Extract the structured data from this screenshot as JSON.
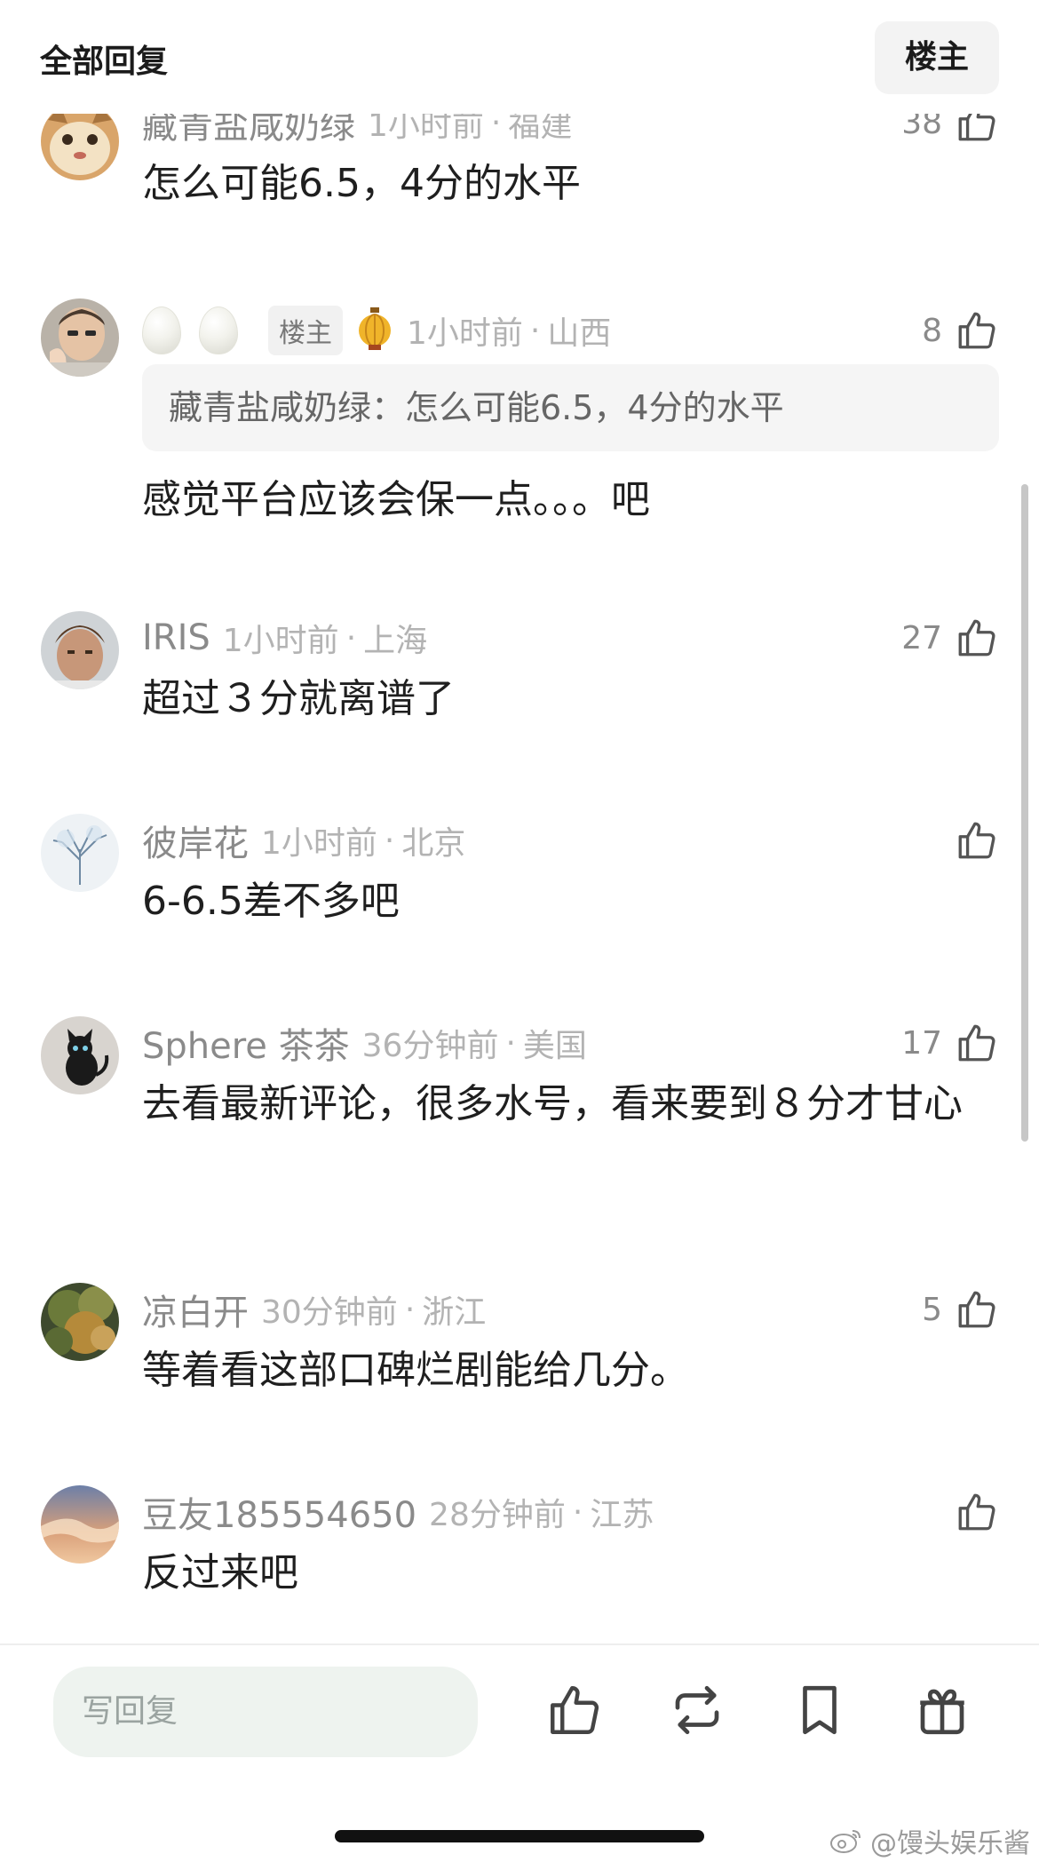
{
  "header": {
    "title": "全部回复",
    "op_button": "楼主"
  },
  "comments": [
    {
      "name": "藏青盐咸奶绿",
      "time": "1小时前",
      "location": "福建",
      "likes": "38",
      "text": "怎么可能6.5，4分的水平"
    },
    {
      "name": "",
      "badge": "楼主",
      "time": "1小时前",
      "location": "山西",
      "likes": "8",
      "quote": "藏青盐咸奶绿：怎么可能6.5，4分的水平",
      "text": "感觉平台应该会保一点。。。吧"
    },
    {
      "name": "IRIS",
      "time": "1小时前",
      "location": "上海",
      "likes": "27",
      "text": "超过３分就离谱了"
    },
    {
      "name": "彼岸花",
      "time": "1小时前",
      "location": "北京",
      "likes": "",
      "text": "6-6.5差不多吧"
    },
    {
      "name": "Sphere 茶茶",
      "time": "36分钟前",
      "location": "美国",
      "likes": "17",
      "text": "去看最新评论，很多水号，看来要到８分才甘心"
    },
    {
      "name": "凉白开",
      "time": "30分钟前",
      "location": "浙江",
      "likes": "5",
      "text": "等着看这部口碑烂剧能给几分。"
    },
    {
      "name": "豆友185554650",
      "time": "28分钟前",
      "location": "江苏",
      "likes": "",
      "text": "反过来吧"
    }
  ],
  "separator": "·",
  "bottom": {
    "reply_placeholder": "写回复",
    "watermark": "@馒头娱乐酱"
  },
  "icons": {
    "like": "thumbs-up-icon",
    "repost": "repost-icon",
    "bookmark": "bookmark-icon",
    "gift": "gift-icon",
    "weibo": "weibo-logo-icon",
    "lantern": "lantern-icon",
    "egg": "egg-icon"
  },
  "colors": {
    "meta_gray": "#b3b3b3",
    "name_gray": "#8a8a8a",
    "input_bg": "#eef3ef",
    "quote_bg": "#f5f5f5"
  }
}
